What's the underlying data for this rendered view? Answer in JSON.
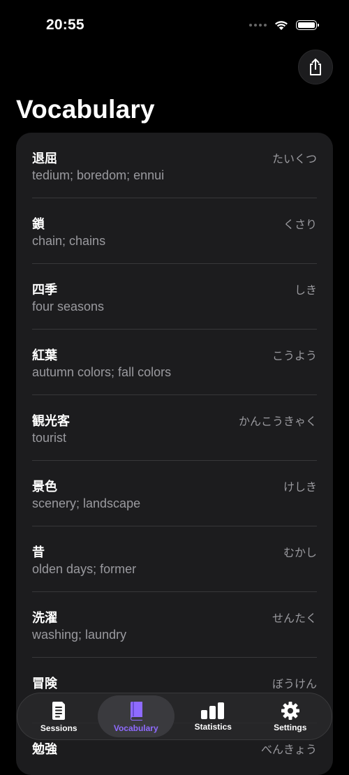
{
  "status_bar": {
    "time": "20:55"
  },
  "header": {
    "title": "Vocabulary"
  },
  "vocabulary": [
    {
      "word": "退屈",
      "reading": "たいくつ",
      "meaning": "tedium; boredom; ennui"
    },
    {
      "word": "鎖",
      "reading": "くさり",
      "meaning": "chain; chains"
    },
    {
      "word": "四季",
      "reading": "しき",
      "meaning": "four seasons"
    },
    {
      "word": "紅葉",
      "reading": "こうよう",
      "meaning": "autumn colors; fall colors"
    },
    {
      "word": "観光客",
      "reading": "かんこうきゃく",
      "meaning": "tourist"
    },
    {
      "word": "景色",
      "reading": "けしき",
      "meaning": "scenery; landscape"
    },
    {
      "word": "昔",
      "reading": "むかし",
      "meaning": "olden days; former"
    },
    {
      "word": "洗濯",
      "reading": "せんたく",
      "meaning": "washing; laundry"
    },
    {
      "word": "冒険",
      "reading": "ぼうけん",
      "meaning": ""
    },
    {
      "word": "勉強",
      "reading": "べんきょう",
      "meaning": ""
    }
  ],
  "tabs": [
    {
      "label": "Sessions",
      "icon": "document-icon",
      "active": false
    },
    {
      "label": "Vocabulary",
      "icon": "book-icon",
      "active": true
    },
    {
      "label": "Statistics",
      "icon": "bar-chart-icon",
      "active": false
    },
    {
      "label": "Settings",
      "icon": "gear-icon",
      "active": false
    }
  ],
  "colors": {
    "accent": "#8f6bff",
    "background": "#000000",
    "card": "#1c1c1e",
    "secondary_text": "#9a9a9f"
  }
}
